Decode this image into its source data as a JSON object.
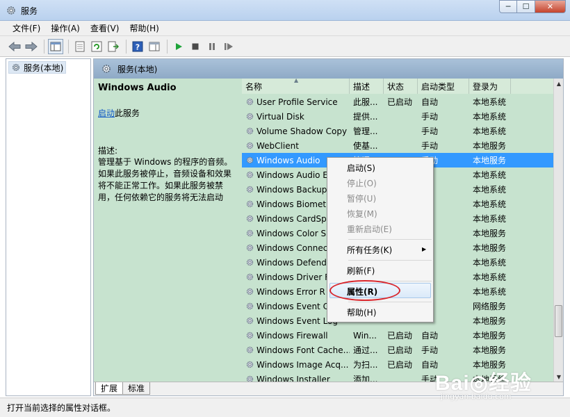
{
  "window": {
    "title": "服务",
    "controls": [
      "─",
      "☐",
      "✕"
    ]
  },
  "menubar": [
    "文件(F)",
    "操作(A)",
    "查看(V)",
    "帮助(H)"
  ],
  "tree": {
    "root": "服务(本地)"
  },
  "panel": {
    "header": "服务(本地)"
  },
  "details": {
    "title": "Windows Audio",
    "start_link": "启动",
    "start_suffix": "此服务",
    "desc_label": "描述:",
    "desc_text": "管理基于 Windows 的程序的音频。如果此服务被停止，音频设备和效果将不能正常工作。如果此服务被禁用，任何依赖它的服务将无法启动"
  },
  "table": {
    "columns": [
      "名称",
      "描述",
      "状态",
      "启动类型",
      "登录为"
    ],
    "rows": [
      [
        "User Profile Service",
        "此服...",
        "已启动",
        "自动",
        "本地系统"
      ],
      [
        "Virtual Disk",
        "提供...",
        "",
        "手动",
        "本地系统"
      ],
      [
        "Volume Shadow Copy",
        "管理...",
        "",
        "手动",
        "本地系统"
      ],
      [
        "WebClient",
        "使基...",
        "",
        "手动",
        "本地服务"
      ],
      [
        "Windows Audio",
        "管理...",
        "",
        "手动",
        "本地服务"
      ],
      [
        "Windows Audio E",
        "",
        "",
        "",
        "本地系统"
      ],
      [
        "Windows Backup",
        "",
        "",
        "",
        "本地系统"
      ],
      [
        "Windows Biometr",
        "",
        "",
        "",
        "本地系统"
      ],
      [
        "Windows CardSp",
        "",
        "",
        "",
        "本地系统"
      ],
      [
        "Windows Color S",
        "",
        "",
        "",
        "本地服务"
      ],
      [
        "Windows Connec",
        "",
        "",
        "",
        "本地服务"
      ],
      [
        "Windows Defend",
        "",
        "",
        "用",
        "本地系统"
      ],
      [
        "Windows Driver F",
        "",
        "",
        "",
        "本地系统"
      ],
      [
        "Windows Error R",
        "",
        "",
        "",
        "本地系统"
      ],
      [
        "Windows Event C",
        "",
        "",
        "",
        "网络服务"
      ],
      [
        "Windows Event Log",
        "",
        "",
        "",
        "本地服务"
      ],
      [
        "Windows Firewall",
        "Win...",
        "已启动",
        "自动",
        "本地服务"
      ],
      [
        "Windows Font Cache...",
        "通过...",
        "已启动",
        "手动",
        "本地服务"
      ],
      [
        "Windows Image Acq...",
        "为扫...",
        "已启动",
        "自动",
        "本地服务"
      ],
      [
        "Windows Installer",
        "添加...",
        "",
        "手动",
        "本地系统"
      ]
    ],
    "selected_index": 4
  },
  "context_menu": {
    "items": [
      {
        "label": "启动(S)",
        "disabled": false
      },
      {
        "label": "停止(O)",
        "disabled": true
      },
      {
        "label": "暂停(U)",
        "disabled": true
      },
      {
        "label": "恢复(M)",
        "disabled": true
      },
      {
        "label": "重新启动(E)",
        "disabled": true
      },
      {
        "label": "所有任务(K)",
        "disabled": false,
        "submenu": true
      },
      {
        "label": "刷新(F)",
        "disabled": false
      },
      {
        "label": "属性(R)",
        "disabled": false,
        "highlighted": true
      },
      {
        "label": "帮助(H)",
        "disabled": false
      }
    ],
    "submenu_arrow": "▶"
  },
  "tabs": [
    "扩展",
    "标准"
  ],
  "statusbar": "打开当前选择的属性对话框。",
  "watermark": {
    "logo": "Bai◎经验",
    "url": "jingyan.baidu.com"
  },
  "colors": {
    "selected_row": "#3399ff",
    "panel_bg": "#c7e3cf",
    "link": "#0b56c5",
    "annotation": "#d9262c"
  }
}
